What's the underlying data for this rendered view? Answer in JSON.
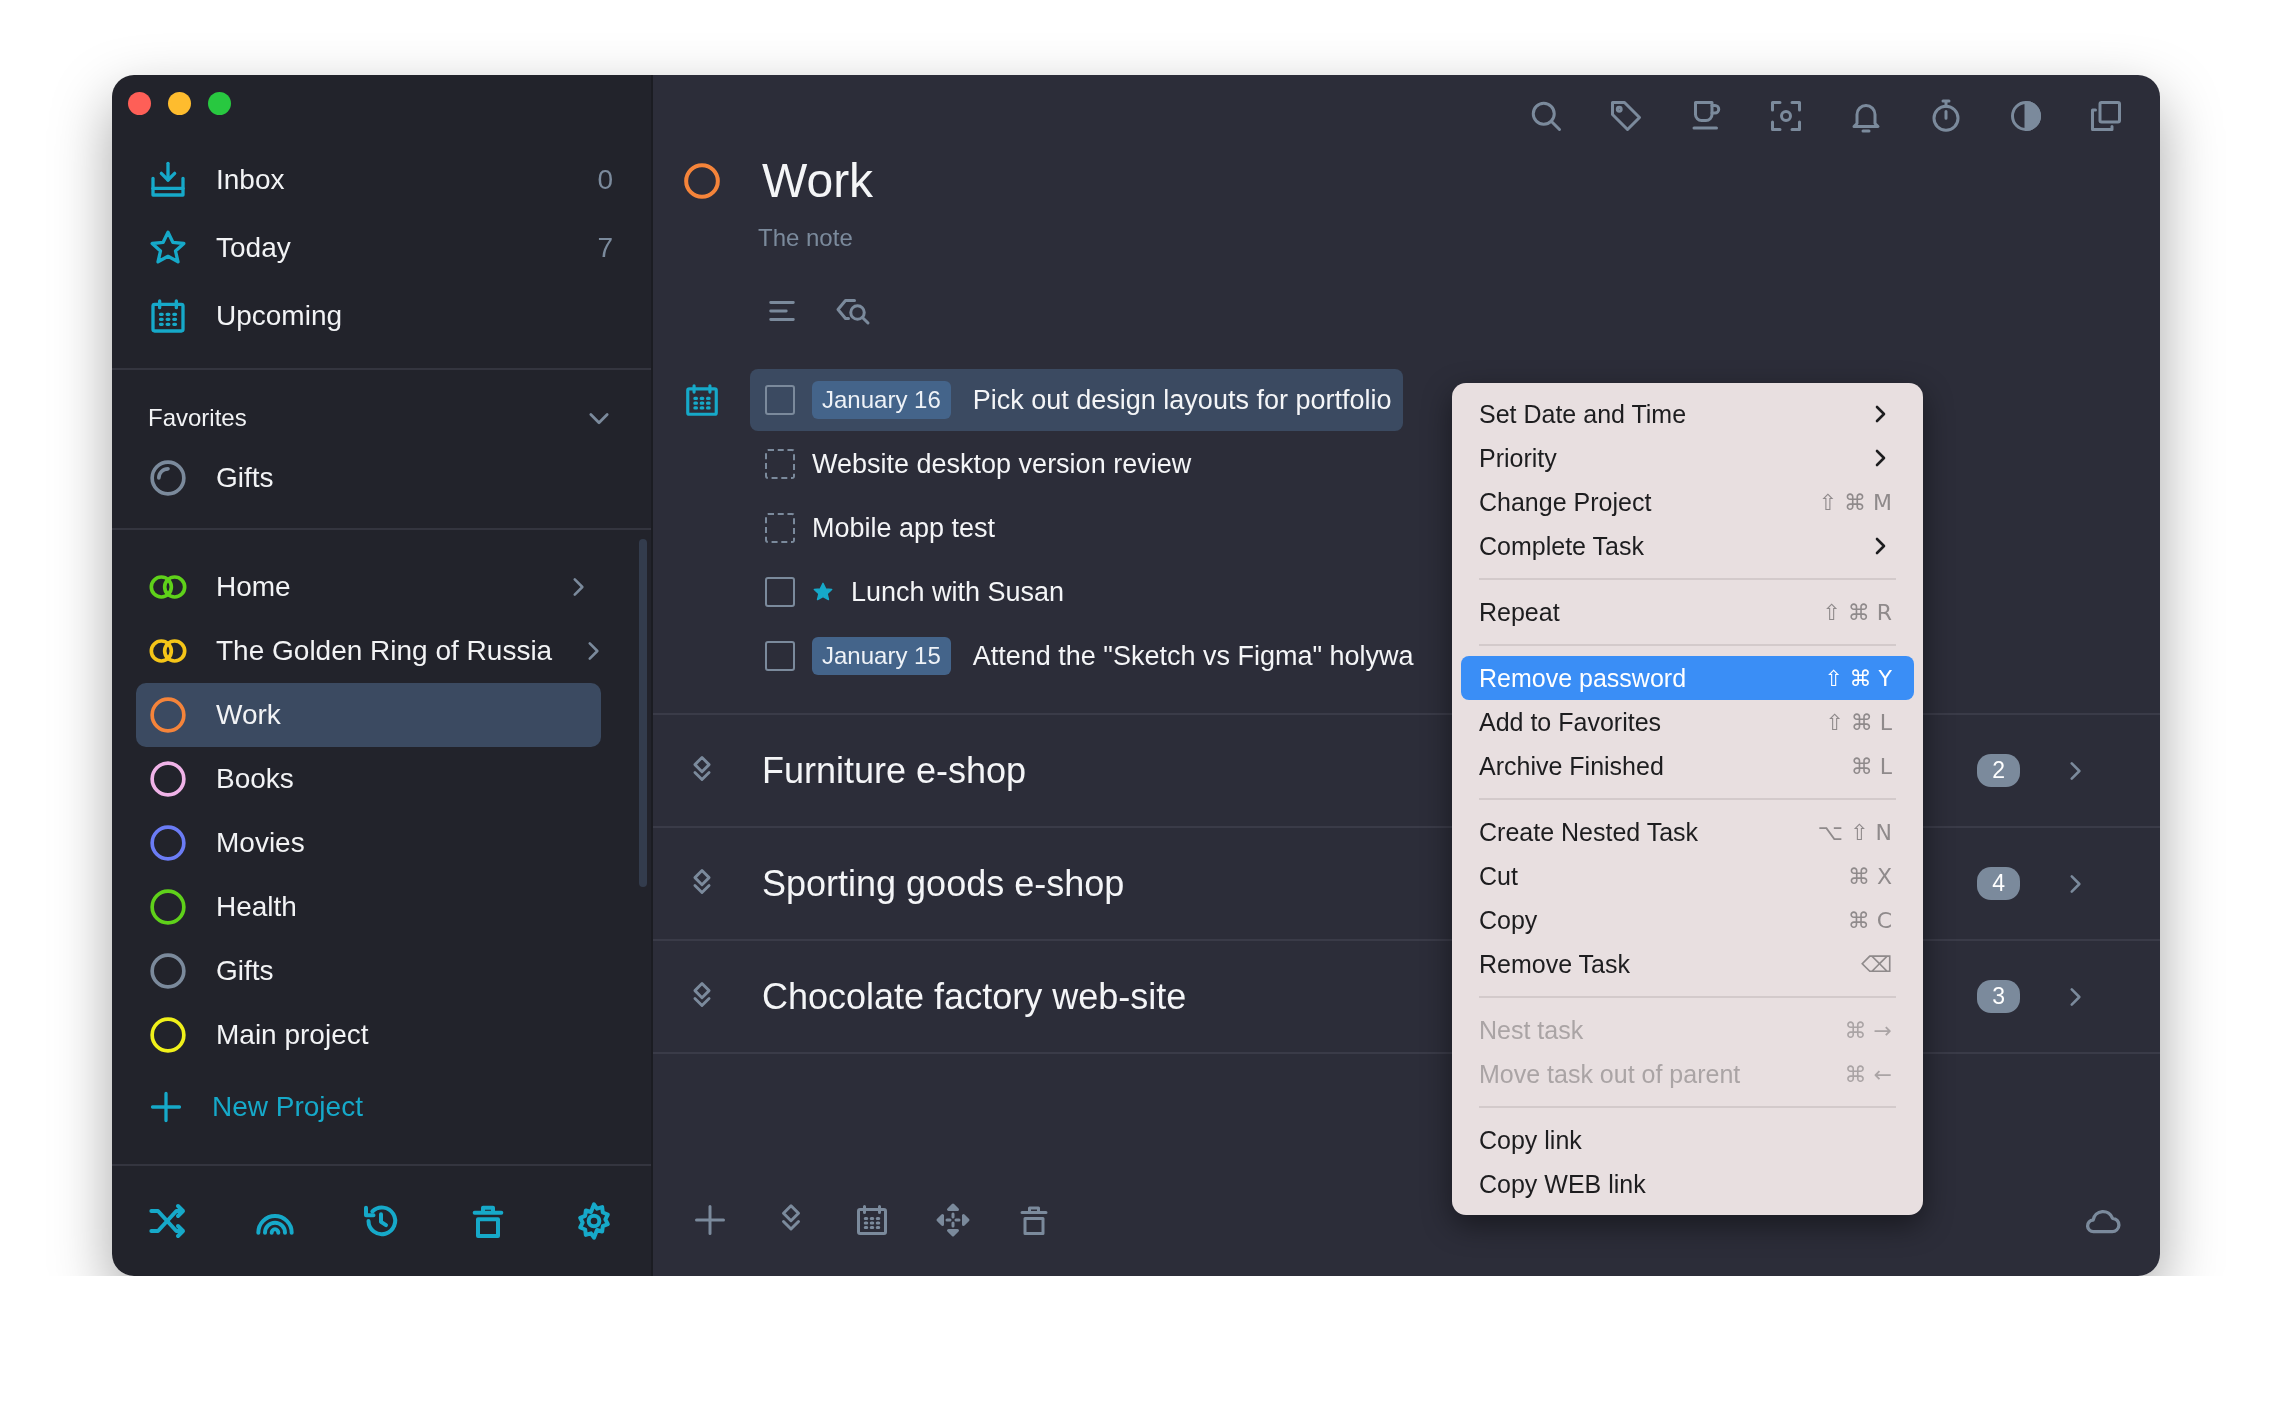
{
  "sidebar": {
    "nav": [
      {
        "label": "Inbox",
        "count": "0",
        "selected": false
      },
      {
        "label": "Today",
        "count": "7",
        "selected": false
      },
      {
        "label": "Upcoming",
        "selected": false
      }
    ],
    "favorites": {
      "title": "Favorites",
      "expanded": true,
      "items": [
        {
          "label": "Gifts",
          "kind": "progress",
          "color": "#7b8a9c",
          "selected": false
        }
      ]
    },
    "projects": [
      {
        "label": "Home",
        "kind": "folder",
        "color": "#5fd11a",
        "selected": false
      },
      {
        "label": "The Golden Ring of Russia",
        "kind": "folder",
        "color": "#f5c518",
        "selected": false
      },
      {
        "label": "Work",
        "kind": "project",
        "color": "#f5843a",
        "selected": true
      },
      {
        "label": "Books",
        "kind": "project",
        "color": "#f0b3e8",
        "selected": false
      },
      {
        "label": "Movies",
        "kind": "project",
        "color": "#6b7cf5",
        "selected": false
      },
      {
        "label": "Health",
        "kind": "project",
        "color": "#5fd11a",
        "selected": false
      },
      {
        "label": "Gifts",
        "kind": "project",
        "color": "#7b8a9c",
        "selected": false
      },
      {
        "label": "Main project",
        "kind": "project",
        "color": "#f0f01a",
        "selected": false
      }
    ],
    "new_project": "New Project"
  },
  "project": {
    "title": "Work",
    "color": "#f5843a",
    "note": "The note"
  },
  "tasks": [
    {
      "kind": "solid",
      "checked": false,
      "starred": false,
      "date": "January 16",
      "text": "Pick out design layouts for portfolio",
      "selected": true
    },
    {
      "kind": "dashed",
      "checked": false,
      "starred": false,
      "text": "Website desktop version review",
      "selected": false
    },
    {
      "kind": "dashed",
      "checked": false,
      "starred": false,
      "text": "Mobile app test",
      "selected": false
    },
    {
      "kind": "solid",
      "checked": false,
      "starred": true,
      "text": "Lunch with Susan",
      "selected": false
    },
    {
      "kind": "solid",
      "checked": false,
      "starred": false,
      "date": "January 15",
      "text": "Attend the \"Sketch vs Figma\" holywa",
      "selected": false
    }
  ],
  "groups": [
    {
      "title": "Furniture e-shop",
      "count": "2"
    },
    {
      "title": "Sporting goods e-shop",
      "count": "4"
    },
    {
      "title": "Chocolate factory web-site",
      "count": "3"
    }
  ],
  "context_menu": {
    "sections": [
      [
        {
          "label": "Set Date and Time",
          "kind": "submenu",
          "disabled": false,
          "selected": false
        },
        {
          "label": "Priority",
          "kind": "submenu",
          "disabled": false,
          "selected": false
        },
        {
          "label": "Change Project",
          "kind": "shortcut",
          "shortcut": "⇧ ⌘ M",
          "disabled": false,
          "selected": false
        },
        {
          "label": "Complete Task",
          "kind": "submenu",
          "disabled": false,
          "selected": false
        }
      ],
      [
        {
          "label": "Repeat",
          "kind": "shortcut",
          "shortcut": "⇧ ⌘ R",
          "disabled": false,
          "selected": false
        }
      ],
      [
        {
          "label": "Remove password",
          "kind": "shortcut",
          "shortcut": "⇧ ⌘ Y",
          "disabled": false,
          "selected": true
        },
        {
          "label": "Add to Favorites",
          "kind": "shortcut",
          "shortcut": "⇧ ⌘ L",
          "disabled": false,
          "selected": false
        },
        {
          "label": "Archive Finished",
          "kind": "shortcut",
          "shortcut": "⌘ L",
          "disabled": false,
          "selected": false
        }
      ],
      [
        {
          "label": "Create Nested Task",
          "kind": "shortcut",
          "shortcut": "⌥ ⇧ N",
          "disabled": false,
          "selected": false
        },
        {
          "label": "Cut",
          "kind": "shortcut",
          "shortcut": "⌘ X",
          "disabled": false,
          "selected": false
        },
        {
          "label": "Copy",
          "kind": "shortcut",
          "shortcut": "⌘ C",
          "disabled": false,
          "selected": false
        },
        {
          "label": "Remove Task",
          "kind": "shortcut",
          "shortcut": "⌫",
          "disabled": false,
          "selected": false
        }
      ],
      [
        {
          "label": "Nest task",
          "kind": "shortcut",
          "shortcut": "⌘ →",
          "disabled": true,
          "selected": false
        },
        {
          "label": "Move task out of parent",
          "kind": "shortcut",
          "shortcut": "⌘ ←",
          "disabled": true,
          "selected": false
        }
      ],
      [
        {
          "label": "Copy link",
          "kind": "plain",
          "disabled": false,
          "selected": false
        },
        {
          "label": "Copy WEB link",
          "kind": "plain",
          "disabled": false,
          "selected": false
        }
      ]
    ]
  }
}
